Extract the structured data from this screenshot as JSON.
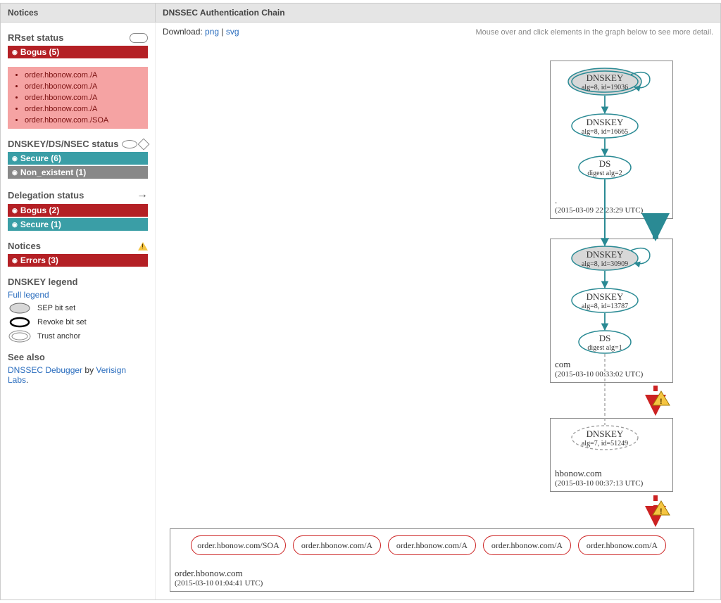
{
  "header": {
    "notices_title": "Notices",
    "main_title": "DNSSEC Authentication Chain",
    "download_label": "Download:",
    "download_png": "png",
    "download_svg": "svg",
    "hint": "Mouse over and click elements in the graph below to see more detail."
  },
  "sidebar": {
    "rrset": {
      "title": "RRset status",
      "bogus_label": "Bogus (5)",
      "items": [
        "order.hbonow.com./A",
        "order.hbonow.com./A",
        "order.hbonow.com./A",
        "order.hbonow.com./A",
        "order.hbonow.com./SOA"
      ]
    },
    "dnskey": {
      "title": "DNSKEY/DS/NSEC status",
      "secure_label": "Secure (6)",
      "nonexist_label": "Non_existent (1)"
    },
    "delegation": {
      "title": "Delegation status",
      "bogus_label": "Bogus (2)",
      "secure_label": "Secure (1)"
    },
    "notices": {
      "title": "Notices",
      "errors_label": "Errors (3)"
    },
    "legend": {
      "title": "DNSKEY legend",
      "full_link": "Full legend",
      "sep": "SEP bit set",
      "revoke": "Revoke bit set",
      "trust": "Trust anchor"
    },
    "seealso": {
      "title": "See also",
      "link1": "DNSSEC Debugger",
      "mid": " by ",
      "link2": "Verisign Labs",
      "tail": "."
    }
  },
  "graph": {
    "zones": [
      {
        "name": ".",
        "ts": "(2015-03-09 22:23:29 UTC)"
      },
      {
        "name": "com",
        "ts": "(2015-03-10 00:33:02 UTC)"
      },
      {
        "name": "hbonow.com",
        "ts": "(2015-03-10 00:37:13 UTC)"
      },
      {
        "name": "order.hbonow.com",
        "ts": "(2015-03-10 01:04:41 UTC)"
      }
    ],
    "nodes": {
      "root_ksk": {
        "t": "DNSKEY",
        "s": "alg=8, id=19036"
      },
      "root_zsk": {
        "t": "DNSKEY",
        "s": "alg=8, id=16665"
      },
      "root_ds": {
        "t": "DS",
        "s": "digest alg=2"
      },
      "com_ksk": {
        "t": "DNSKEY",
        "s": "alg=8, id=30909"
      },
      "com_zsk": {
        "t": "DNSKEY",
        "s": "alg=8, id=13787"
      },
      "com_ds": {
        "t": "DS",
        "s": "digest alg=1"
      },
      "hbo_key": {
        "t": "DNSKEY",
        "s": "alg=7, id=51249"
      }
    },
    "rrsets": [
      "order.hbonow.com/SOA",
      "order.hbonow.com/A",
      "order.hbonow.com/A",
      "order.hbonow.com/A",
      "order.hbonow.com/A"
    ]
  }
}
